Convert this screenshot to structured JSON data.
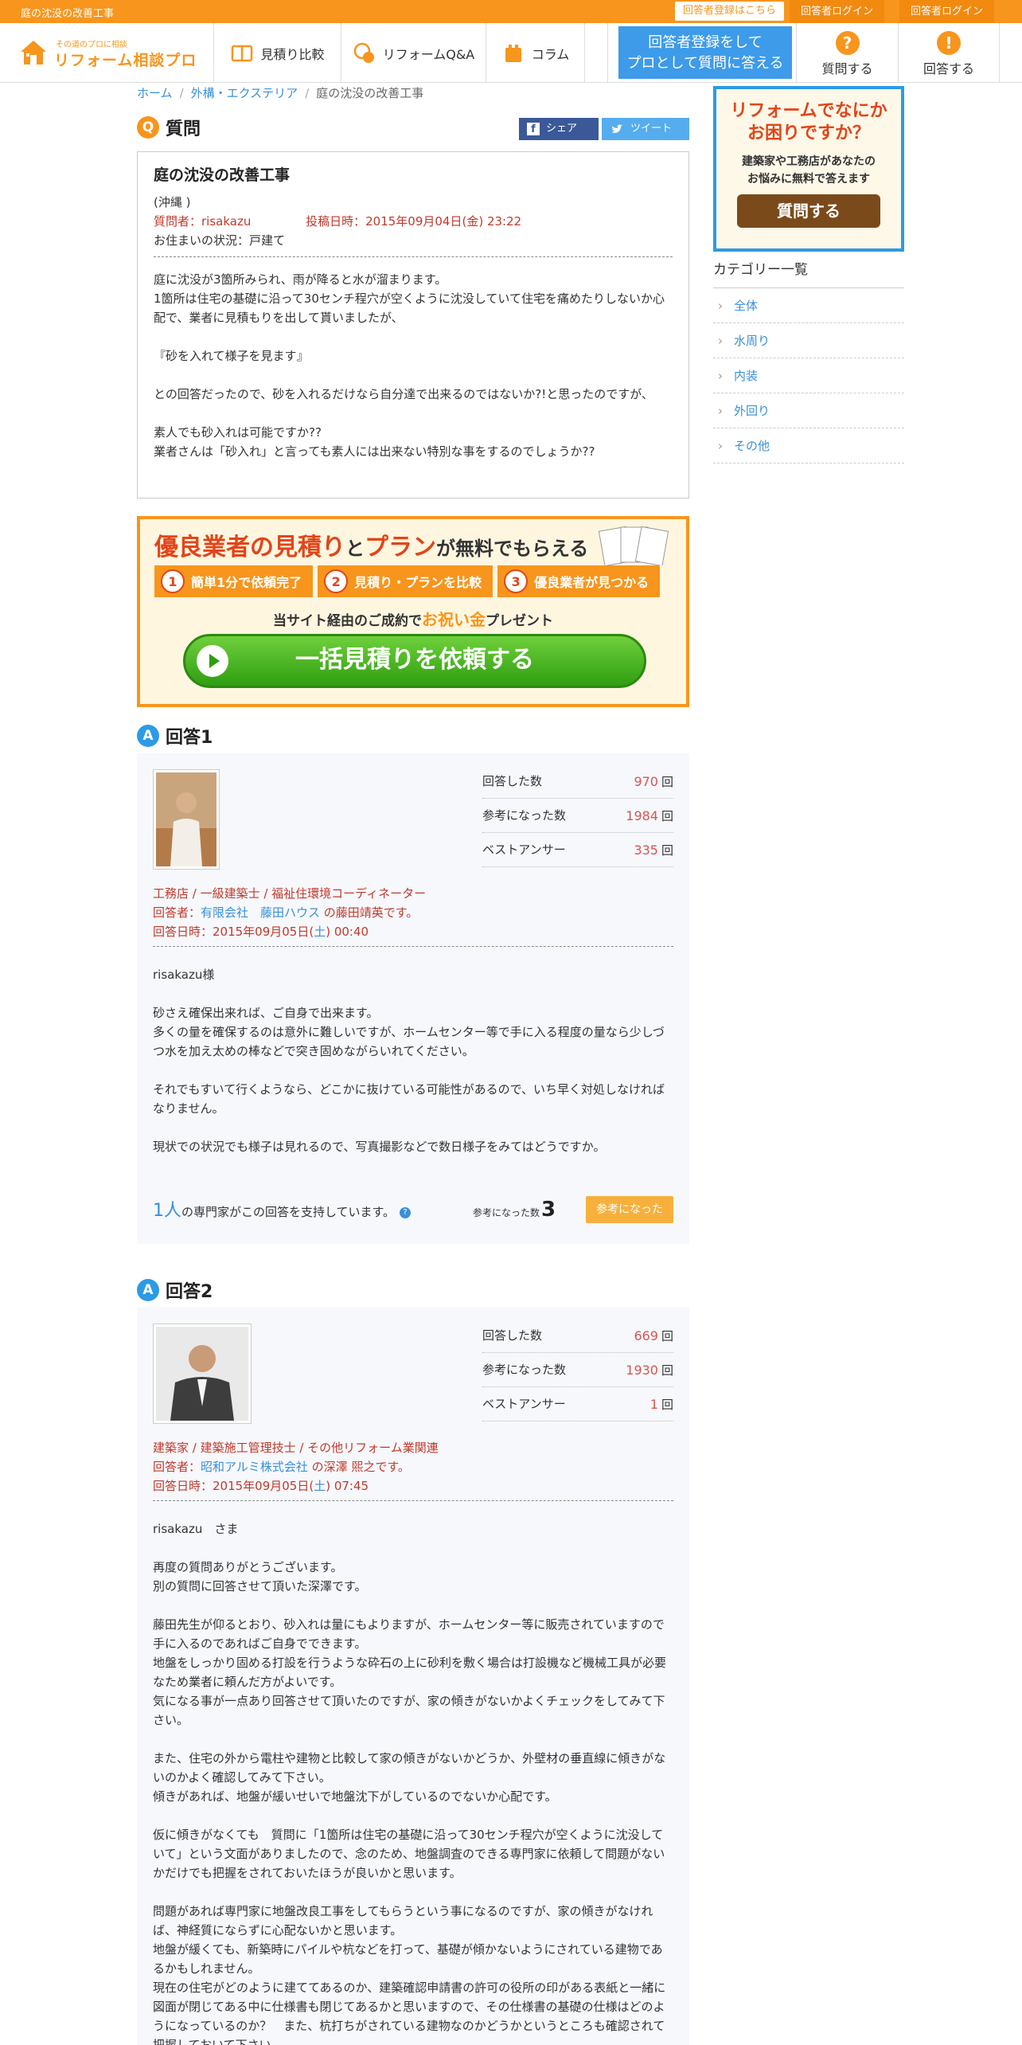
{
  "topbar": {
    "site_title": "庭の沈没の改善工事",
    "register_link": "回答者登録はこちら",
    "login_1": "回答者ログイン",
    "login_2": "回答者ログイン"
  },
  "header": {
    "logo_tagline": "その道のプロに相談",
    "logo_name": "リフォーム相談プロ",
    "nav": [
      {
        "label": "見積り比較",
        "icon": "booklet-icon"
      },
      {
        "label": "リフォームQ&A",
        "icon": "qa-icon"
      },
      {
        "label": "コラム",
        "icon": "column-icon"
      }
    ],
    "cta_line1": "回答者登録をして",
    "cta_line2": "プロとして質問に答える",
    "ask_button": {
      "label": "質問する",
      "icon_text": "?"
    },
    "answer_button": {
      "label": "回答する",
      "icon_text": "!"
    }
  },
  "breadcrumb": [
    "ホーム",
    "外構・エクステリア",
    "庭の沈没の改善工事"
  ],
  "question": {
    "badge": "Q",
    "section_label": "質問",
    "share_fb": "シェア",
    "share_tw": "ツイート",
    "title": "庭の沈没の改善工事",
    "location": "(沖縄 )",
    "asker": "質問者：risakazu",
    "posted": "投稿日時：2015年09月04日(金) 23:22",
    "residence": "お住まいの状況：戸建て",
    "body": "庭に沈没が3箇所みられ、雨が降ると水が溜まります。\n1箇所は住宅の基礎に沿って30センチ程穴が空くように沈没していて住宅を痛めたりしないか心配で、業者に見積もりを出して貰いましたが、\n\n『砂を入れて様子を見ます』\n\nとの回答だったので、砂を入れるだけなら自分達で出来るのではないか?!と思ったのですが、\n\n素人でも砂入れは可能ですか??\n業者さんは「砂入れ」と言っても素人には出来ない特別な事をするのでしょうか??"
  },
  "banner": {
    "headline_1": "優良業者の見積り",
    "headline_2": "と",
    "headline_3": "プラン",
    "headline_4": "が無料でもらえる",
    "steps": [
      "簡単1分で依頼完了",
      "見積り・プランを比較",
      "優良業者が見つかる"
    ],
    "step_nums": [
      "1",
      "2",
      "3"
    ],
    "gift_1": "当サイト経由のご成約で",
    "gift_2": "お祝い金",
    "gift_3": "プレゼント",
    "button": "一括見積りを依頼する"
  },
  "answers": [
    {
      "badge": "A",
      "label": "回答1",
      "stats": [
        {
          "label": "回答した数",
          "value": "970",
          "unit": "回"
        },
        {
          "label": "参考になった数",
          "value": "1984",
          "unit": "回"
        },
        {
          "label": "ベストアンサー",
          "value": "335",
          "unit": "回"
        }
      ],
      "profession": "工務店 / 一級建築士 / 福祉住環境コーディネーター",
      "responder_prefix": "回答者：",
      "responder_link": "有限会社　藤田ハウス",
      "responder_suffix": " の藤田靖英です。",
      "date_prefix": "回答日時：2015年09月05日(",
      "date_day": "土",
      "date_suffix": ") 00:40",
      "body": "risakazu様\n\n砂さえ確保出来れば、ご自身で出来ます。\n多くの量を確保するのは意外に難しいですが、ホームセンター等で手に入る程度の量なら少しづつ水を加え太めの棒などで突き固めながらいれてください。\n\nそれでもすいて行くようなら、どこかに抜けている可能性があるので、いち早く対処しなければなりません。\n\n現状での状況でも様子は見れるので、写真撮影などで数日様子をみてはどうですか。",
      "support_count": "1人",
      "support_text": "の専門家がこの回答を支持しています。",
      "helped_label": "参考になった数",
      "helped_count": "3",
      "helped_button": "参考になった"
    },
    {
      "badge": "A",
      "label": "回答2",
      "stats": [
        {
          "label": "回答した数",
          "value": "669",
          "unit": "回"
        },
        {
          "label": "参考になった数",
          "value": "1930",
          "unit": "回"
        },
        {
          "label": "ベストアンサー",
          "value": "1",
          "unit": "回"
        }
      ],
      "profession": "建築家 / 建築施工管理技士 / その他リフォーム業関連",
      "responder_prefix": "回答者：",
      "responder_link": "昭和アルミ株式会社",
      "responder_suffix": " の深澤 煕之です。",
      "date_prefix": "回答日時：2015年09月05日(",
      "date_day": "土",
      "date_suffix": ") 07:45",
      "body": "risakazu　さま\n\n再度の質問ありがとうございます。\n別の質問に回答させて頂いた深澤です。\n\n藤田先生が仰るとおり、砂入れは量にもよりますが、ホームセンター等に販売されていますので手に入るのであればご自身でできます。\n地盤をしっかり固める打設を行うような砕石の上に砂利を敷く場合は打設機など機械工具が必要なため業者に頼んだ方がよいです。\n気になる事が一点あり回答させて頂いたのですが、家の傾きがないかよくチェックをしてみて下さい。\n\nまた、住宅の外から電柱や建物と比較して家の傾きがないかどうか、外壁材の垂直線に傾きがないのかよく確認してみて下さい。\n傾きがあれば、地盤が緩いせいで地盤沈下がしているのでないか心配です。\n\n仮に傾きがなくても　質問に「1箇所は住宅の基礎に沿って30センチ程穴が空くように沈没していて」という文面がありましたので、念のため、地盤調査のできる専門家に依頼して問題がないかだけでも把握をされておいたほうが良いかと思います。\n\n問題があれば専門家に地盤改良工事をしてもらうという事になるのですが、家の傾きがなければ、神経質にならずに心配ないかと思います。\n地盤が緩くても、新築時にパイルや杭などを打って、基礎が傾かないようにされている建物であるかもしれません。\n現在の住宅がどのように建ててあるのか、建築確認申請書の許可の役所の印がある表紙と一緒に図面が閉じてある中に仕様書も閉じてあるかと思いますので、その仕様書の基礎の仕様はどのようになっているのか？　また、杭打ちがされている建物なのかどうかというところも確認されて把握しておいて下さい。"
    }
  ],
  "sidebar": {
    "ad_line1": "リフォームでなにか",
    "ad_line2": "お困りですか？",
    "ad_line3": "建築家や工務店があなたの",
    "ad_line4": "お悩みに無料で答えます",
    "ad_button": "質問する",
    "category_title": "カテゴリー一覧",
    "categories": [
      "全体",
      "水周り",
      "内装",
      "外回り",
      "その他"
    ]
  },
  "colors": {
    "brand_orange": "#f7951d",
    "link_blue": "#3a8fd8",
    "accent_red": "#c0392b",
    "answer_blue": "#2c9ae4"
  }
}
